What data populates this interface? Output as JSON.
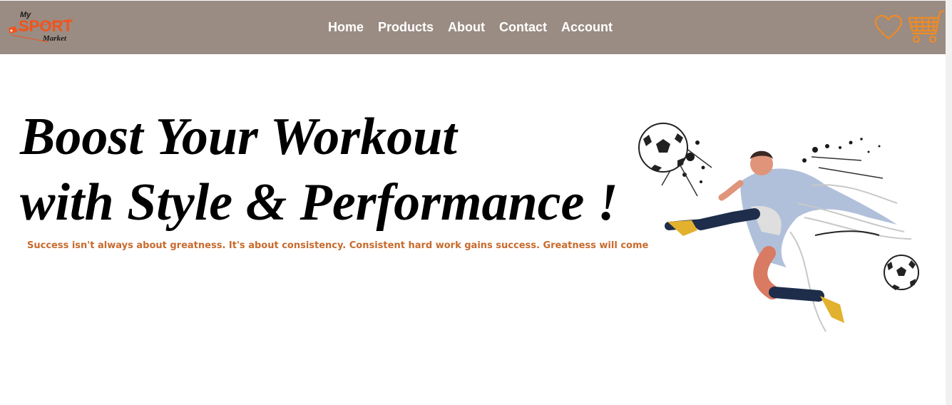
{
  "brand": {
    "line1": "My",
    "line2": "SPORT",
    "line3": "Market",
    "accent_color": "#f0541e"
  },
  "nav": {
    "background": "#9a8c82",
    "links": [
      {
        "label": "Home"
      },
      {
        "label": "Products"
      },
      {
        "label": "About"
      },
      {
        "label": "Contact"
      },
      {
        "label": "Account"
      }
    ]
  },
  "icons": {
    "wishlist": "heart-icon",
    "cart": "shopping-cart-icon",
    "color": "#f08a24"
  },
  "hero": {
    "title_line1": "Boost Your Workout",
    "title_line2": "with Style & Performance !",
    "subtitle": "Success isn't always about greatness. It's about consistency. Consistent hard work gains success. Greatness will come",
    "subtitle_color": "#c86a2c",
    "image": "soccer-player-kicking-ball-illustration"
  }
}
